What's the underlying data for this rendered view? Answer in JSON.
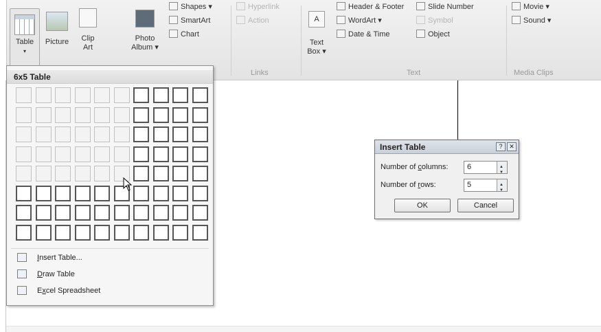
{
  "ribbon": {
    "table_label": "Table",
    "picture_label": "Picture",
    "clip_label": "Clip",
    "art_label": "Art",
    "photo_label": "Photo",
    "album_label": "Album ▾",
    "shapes_label": "Shapes ▾",
    "smartart_label": "SmartArt",
    "chart_label": "Chart",
    "hyperlink_label": "Hyperlink",
    "action_label": "Action",
    "links_group": "Links",
    "textbox_label": "Text",
    "box_label": "Box ▾",
    "header_footer_label": "Header & Footer",
    "wordart_label": "WordArt ▾",
    "date_time_label": "Date & Time",
    "slide_number_label": "Slide Number",
    "symbol_label": "Symbol",
    "object_label": "Object",
    "text_group": "Text",
    "movie_label": "Movie ▾",
    "sound_label": "Sound ▾",
    "media_group": "Media Clips"
  },
  "table_dropdown": {
    "header": "6x5 Table",
    "items": [
      {
        "pre": "",
        "accel": "I",
        "post": "nsert Table..."
      },
      {
        "pre": "",
        "accel": "D",
        "post": "raw Table"
      },
      {
        "pre": "E",
        "accel": "x",
        "post": "cel Spreadsheet"
      }
    ]
  },
  "dialog": {
    "title": "Insert Table",
    "columns_pre": "Number of ",
    "columns_accel": "c",
    "columns_post": "olumns:",
    "columns_value": "6",
    "rows_pre": "Number of ",
    "rows_accel": "r",
    "rows_post": "ows:",
    "rows_value": "5",
    "ok_label": "OK",
    "cancel_label": "Cancel",
    "help_glyph": "?",
    "close_glyph": "✕"
  }
}
